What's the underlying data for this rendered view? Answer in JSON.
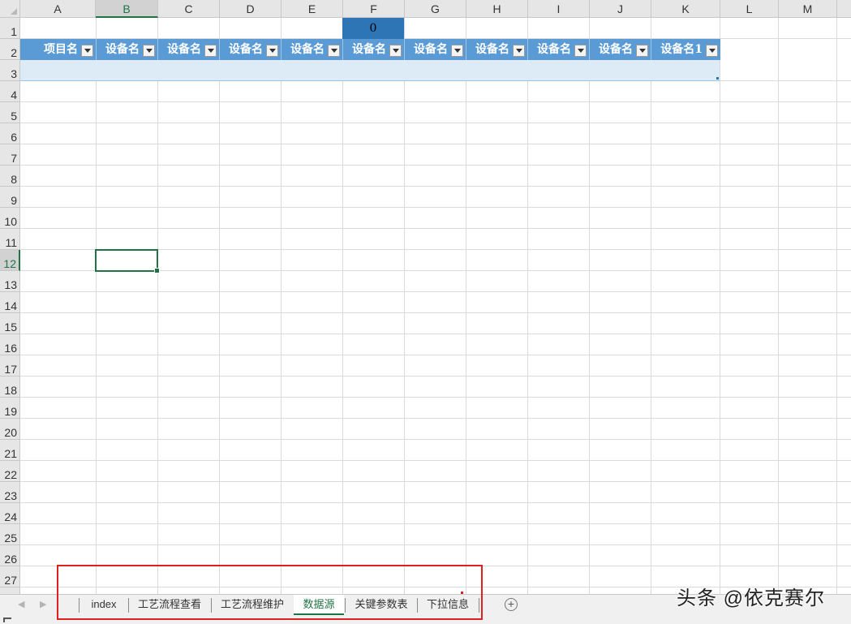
{
  "spreadsheet": {
    "columns": [
      "A",
      "B",
      "C",
      "D",
      "E",
      "F",
      "G",
      "H",
      "I",
      "J",
      "K",
      "L",
      "M"
    ],
    "selected_column": "B",
    "rows": [
      "1",
      "2",
      "3",
      "4",
      "5",
      "6",
      "7",
      "8",
      "9",
      "10",
      "11",
      "12",
      "13",
      "14",
      "15",
      "16",
      "17",
      "18",
      "19",
      "20",
      "21",
      "22",
      "23",
      "24",
      "25",
      "26",
      "27"
    ],
    "selected_row": "12",
    "cell_f1": "0",
    "table_headers": [
      "项目名",
      "设备名",
      "设备名",
      "设备名",
      "设备名",
      "设备名",
      "设备名",
      "设备名",
      "设备名",
      "设备名",
      "设备名1"
    ],
    "filter_icon": "dropdown-arrow-icon"
  },
  "sheet_tabs": {
    "tabs": [
      "index",
      "工艺流程查看",
      "工艺流程维护",
      "数据源",
      "关键参数表",
      "下拉信息"
    ],
    "active_tab": "数据源",
    "add_icon": "plus-circle-icon",
    "nav_prev_icon": "triangle-left-icon",
    "nav_next_icon": "triangle-right-icon"
  },
  "watermark": "头条 @依克赛尔",
  "colors": {
    "table_header": "#5b9bd5",
    "table_row": "#ddebf7",
    "highlight_cell": "#2e75b6",
    "selection": "#217346",
    "annotation_box": "#e0201e"
  }
}
